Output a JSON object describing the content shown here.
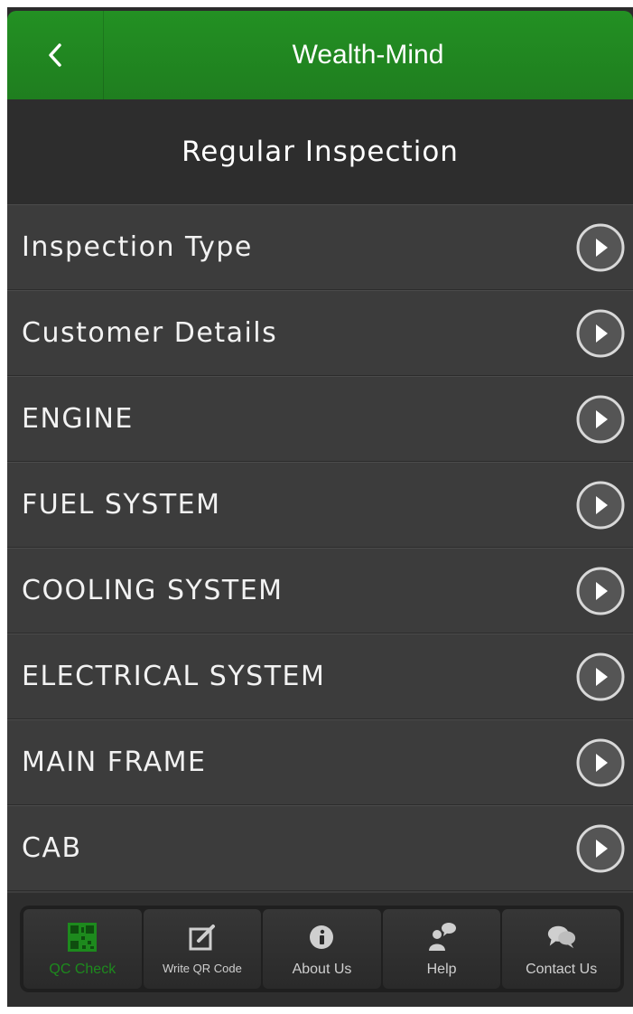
{
  "header": {
    "back_label": "<",
    "title": "Wealth-Mind",
    "bar_color": "#239023"
  },
  "subheader": {
    "title": "Regular Inspection"
  },
  "list": {
    "items": [
      {
        "label": "Inspection Type",
        "icon": "play-circle-icon"
      },
      {
        "label": "Customer Details",
        "icon": "play-circle-icon"
      },
      {
        "label": "ENGINE",
        "icon": "play-circle-icon"
      },
      {
        "label": "FUEL SYSTEM",
        "icon": "play-circle-icon"
      },
      {
        "label": "COOLING SYSTEM",
        "icon": "play-circle-icon"
      },
      {
        "label": "ELECTRICAL SYSTEM",
        "icon": "play-circle-icon"
      },
      {
        "label": "MAIN FRAME",
        "icon": "play-circle-icon"
      },
      {
        "label": "CAB",
        "icon": "play-circle-icon"
      }
    ]
  },
  "tabbar": {
    "active_color": "#1d8a1d",
    "tabs": [
      {
        "label": "QC  Check",
        "icon": "qr-code-icon",
        "active": true
      },
      {
        "label": "Write QR Code",
        "icon": "edit-icon",
        "active": false
      },
      {
        "label": "About Us",
        "icon": "info-icon",
        "active": false
      },
      {
        "label": "Help",
        "icon": "help-user-icon",
        "active": false
      },
      {
        "label": "Contact Us",
        "icon": "chat-bubbles-icon",
        "active": false
      }
    ]
  }
}
